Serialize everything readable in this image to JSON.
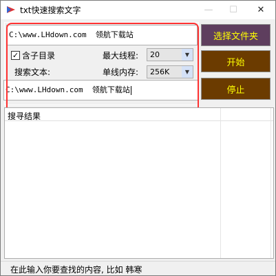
{
  "window": {
    "title": "txt快速搜索文字"
  },
  "titlebar": {
    "minimize_glyph": "—",
    "maximize_glyph": "☐",
    "close_glyph": "✕"
  },
  "options": {
    "folder_path": "C:\\www.LHdown.com  领航下载站",
    "include_subdirs_label": "含子目录",
    "include_subdirs_checked": true,
    "max_threads_label": "最大线程:",
    "max_threads_value": "20",
    "search_text_label": "搜索文本:",
    "single_thread_mem_label": "单线内存:",
    "single_thread_mem_value": "256K",
    "search_text_value": "C:\\www.LHdown.com  领航下载站"
  },
  "buttons": {
    "select_folder": "选择文件夹",
    "start": "开始",
    "stop": "停止"
  },
  "results": {
    "title": "搜寻结果"
  },
  "status": {
    "text": "在此输入你要查找的内容, 比如 韩寒"
  },
  "colors": {
    "button_bg": "#6b3b00",
    "folder_button_bg": "#5e3e5e",
    "button_text": "#ffff00",
    "highlight": "#ff3030"
  },
  "icons": {
    "app": "app-icon",
    "checkbox": "check-icon",
    "dropdown": "chevron-down-icon"
  }
}
